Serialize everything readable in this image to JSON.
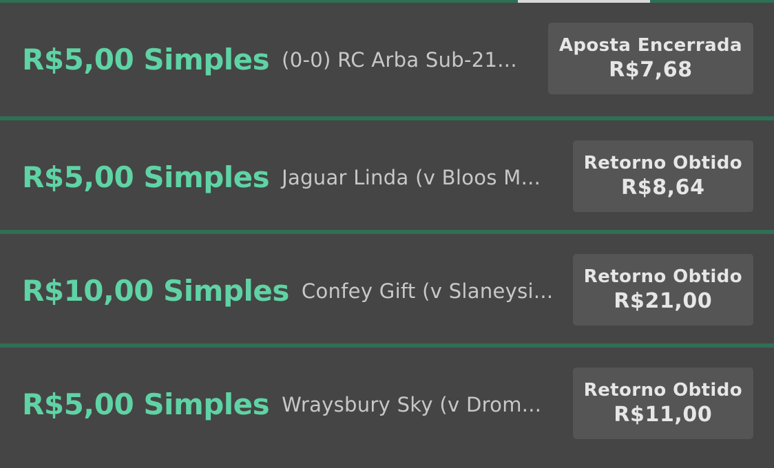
{
  "bets": [
    {
      "stake": "R$5,00 Simples",
      "selection": "(0-0) RC Arba Sub-21...",
      "result_label": "Aposta Encerrada",
      "result_amount": "R$7,68"
    },
    {
      "stake": "R$5,00 Simples",
      "selection": "Jaguar Linda (v Bloos M...",
      "result_label": "Retorno Obtido",
      "result_amount": "R$8,64"
    },
    {
      "stake": "R$10,00 Simples",
      "selection": "Confey Gift (v Slaneysi...",
      "result_label": "Retorno Obtido",
      "result_amount": "R$21,00"
    },
    {
      "stake": "R$5,00 Simples",
      "selection": "Wraysbury Sky (v Drom...",
      "result_label": "Retorno Obtido",
      "result_amount": "R$11,00"
    }
  ],
  "colors": {
    "background": "#454545",
    "accent_green": "#5fd3a5",
    "divider": "#2f6f55",
    "result_box": "#555555"
  }
}
